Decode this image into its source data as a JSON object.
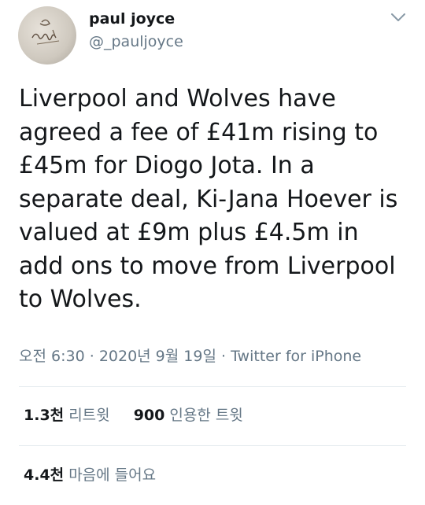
{
  "author": {
    "display_name": "paul joyce",
    "handle": "@_pauljoyce"
  },
  "tweet": {
    "text": "Liverpool and Wolves have\nagreed a fee of £41m rising to\n£45m for Diogo Jota. In a\nseparate deal, Ki-Jana Hoever is\nvalued at £9m plus £4.5m in\nadd ons to move from Liverpool\nto Wolves."
  },
  "meta": {
    "time": "오전 6:30",
    "separator": "·",
    "date": "2020년 9월 19일",
    "source": "Twitter for iPhone"
  },
  "stats": {
    "retweets_count": "1.3천",
    "retweets_label": "리트윗",
    "quote_count": "900",
    "quote_label": "인용한 트윗",
    "likes_count": "4.4천",
    "likes_label": "마음에 들어요"
  },
  "colors": {
    "text": "#14171a",
    "secondary": "#657786",
    "divider": "#e6ecf0"
  },
  "icons": {
    "caret": "chevron-down-icon",
    "avatar": "avatar"
  }
}
